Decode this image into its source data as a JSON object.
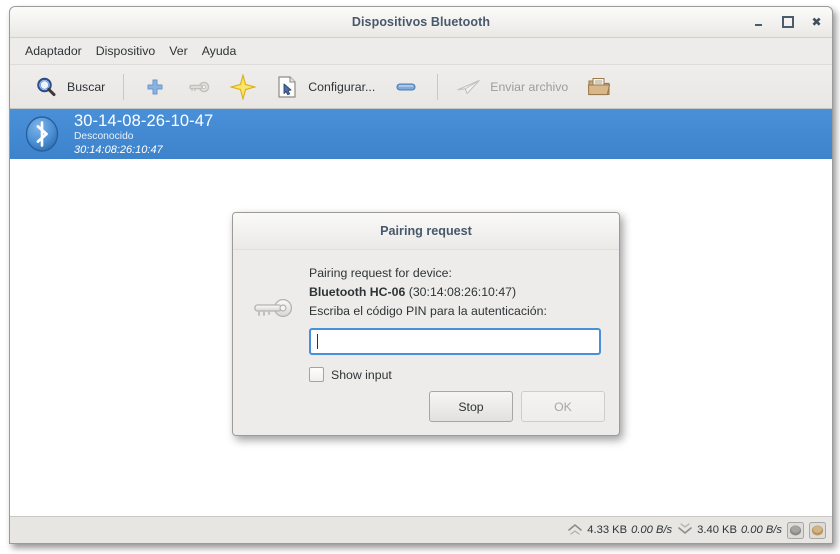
{
  "window": {
    "title": "Dispositivos Bluetooth",
    "controls": {
      "minimize": "minimize",
      "maximize": "maximize",
      "close": "close"
    }
  },
  "menubar": {
    "items": [
      {
        "label": "Adaptador"
      },
      {
        "label": "Dispositivo"
      },
      {
        "label": "Ver"
      },
      {
        "label": "Ayuda"
      }
    ]
  },
  "toolbar": {
    "search_label": "Buscar",
    "search_icon": "magnifier-icon",
    "add_icon": "plus-icon",
    "key_icon": "key-icon",
    "trust_icon": "star-icon",
    "setup_icon": "document-cursor-icon",
    "setup_label": "Configurar...",
    "remove_icon": "minus-icon",
    "send_icon": "paper-plane-icon",
    "send_label": "Enviar archivo",
    "browse_icon": "folder-icon"
  },
  "device_list": {
    "rows": [
      {
        "icon": "bluetooth-icon",
        "name": "30-14-08-26-10-47",
        "status": "Desconocido",
        "address": "30:14:08:26:10:47",
        "selected": true
      }
    ]
  },
  "statusbar": {
    "upload_icon": "chevron-up-icon",
    "upload_total": "4.33 KB",
    "upload_rate": "0.00 B/s",
    "download_icon": "chevron-down-icon",
    "download_total": "3.40 KB",
    "download_rate": "0.00 B/s",
    "tray_icons": [
      "tray-gray-icon",
      "tray-tan-icon"
    ]
  },
  "dialog": {
    "title": "Pairing request",
    "icon": "key-icon",
    "line1": "Pairing request for device:",
    "device_name": "Bluetooth HC-06",
    "device_address": "(30:14:08:26:10:47)",
    "line3": "Escriba el código PIN para la autenticación:",
    "pin_value": "",
    "pin_placeholder": "",
    "show_input_label": "Show input",
    "show_input_checked": false,
    "stop_label": "Stop",
    "ok_label": "OK",
    "ok_disabled": true
  },
  "colors": {
    "accent": "#4a90d9",
    "selection": "#3c83cc",
    "title_text": "#47596b",
    "window_bg": "#edecea"
  }
}
